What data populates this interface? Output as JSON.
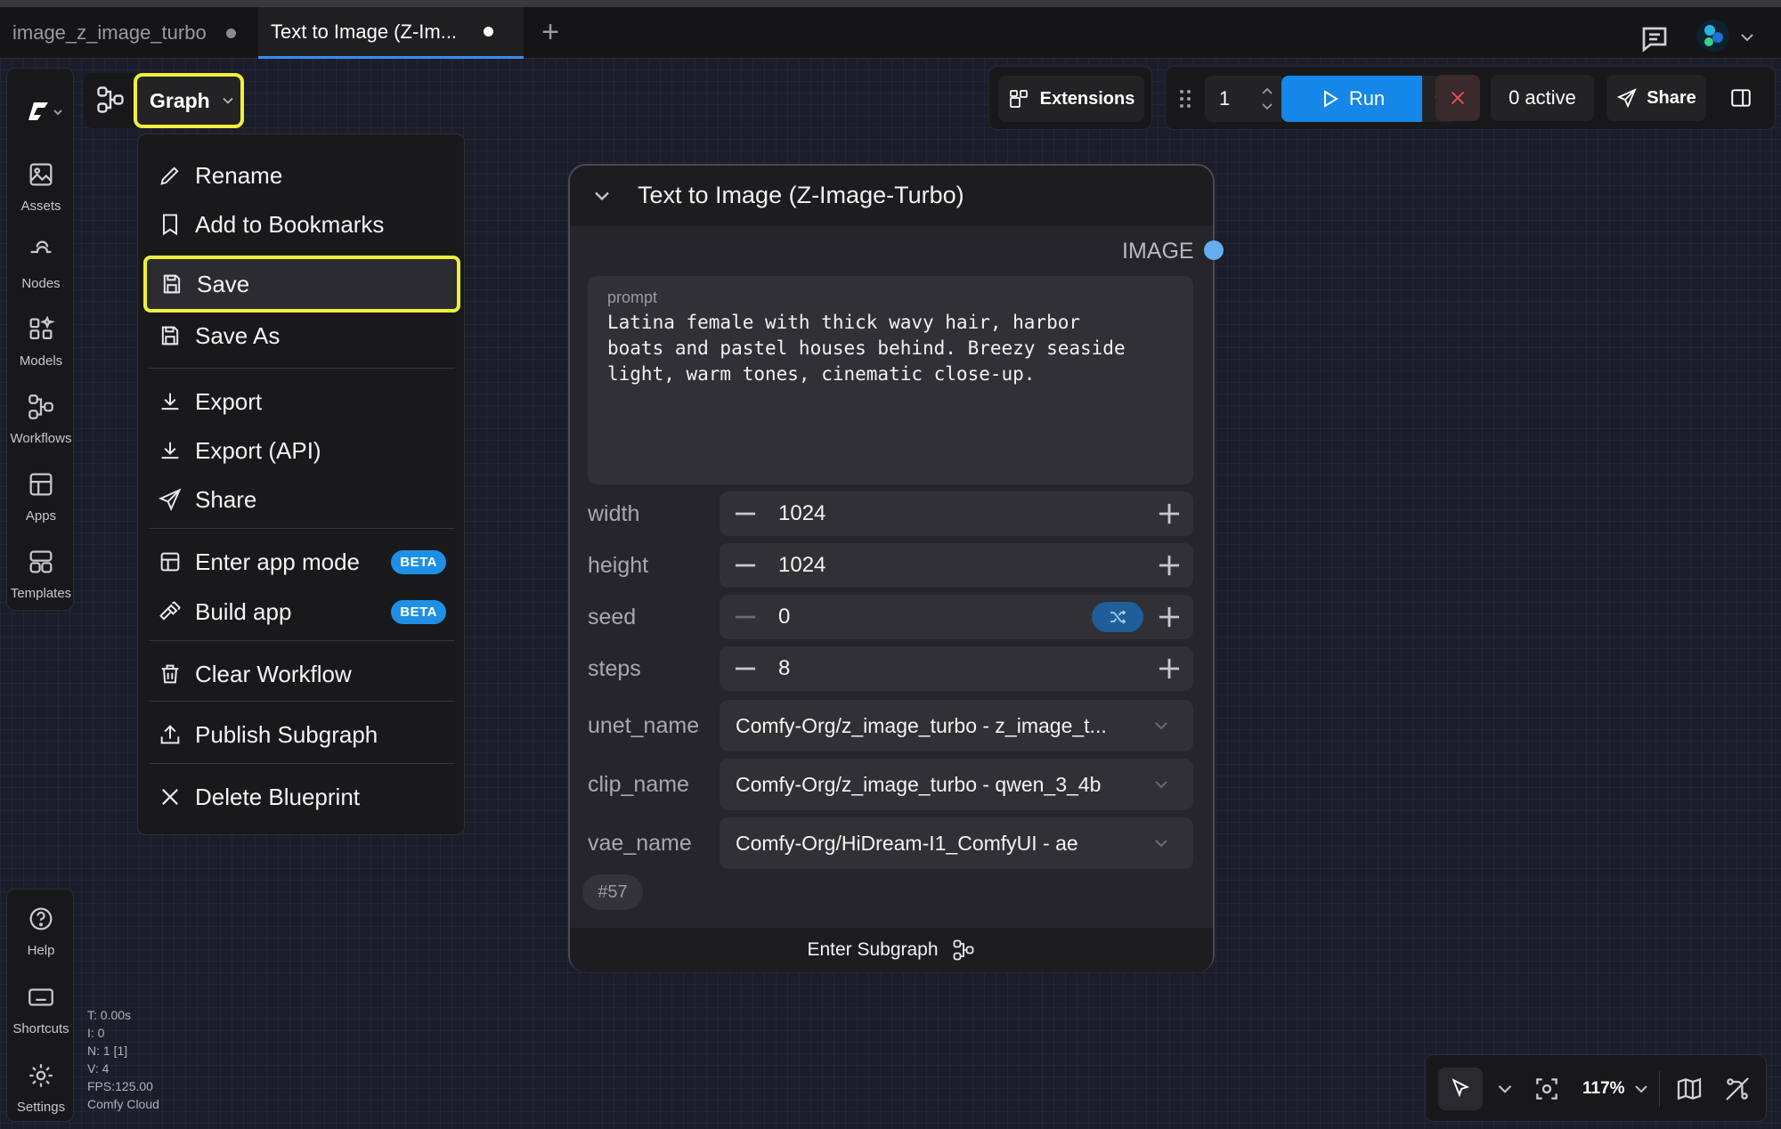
{
  "tabs": [
    {
      "label": "image_z_image_turbo",
      "unsaved": true,
      "active": false
    },
    {
      "label": "Text to Image (Z-Im...",
      "unsaved": true,
      "active": true
    }
  ],
  "tab_add_label": "+",
  "sidebar": {
    "items": [
      {
        "label": "Assets",
        "icon": "image-icon"
      },
      {
        "label": "Nodes",
        "icon": "node-icon"
      },
      {
        "label": "Models",
        "icon": "models-icon"
      },
      {
        "label": "Workflows",
        "icon": "workflow-icon"
      },
      {
        "label": "Apps",
        "icon": "apps-icon"
      },
      {
        "label": "Templates",
        "icon": "templates-icon"
      }
    ],
    "bottom_items": [
      {
        "label": "Help",
        "icon": "help-icon"
      },
      {
        "label": "Shortcuts",
        "icon": "keyboard-icon"
      },
      {
        "label": "Settings",
        "icon": "gear-icon"
      }
    ]
  },
  "graph_button_label": "Graph",
  "menu": {
    "items": [
      {
        "label": "Rename",
        "icon": "pencil-icon"
      },
      {
        "label": "Add to Bookmarks",
        "icon": "bookmark-icon"
      },
      {
        "label": "Save",
        "icon": "save-icon",
        "highlighted": true
      },
      {
        "label": "Save As",
        "icon": "save-icon"
      },
      {
        "label": "Export",
        "icon": "download-icon"
      },
      {
        "label": "Export (API)",
        "icon": "download-icon"
      },
      {
        "label": "Share",
        "icon": "send-icon"
      },
      {
        "label": "Enter app mode",
        "icon": "layout-icon",
        "badge": "BETA"
      },
      {
        "label": "Build app",
        "icon": "hammer-icon",
        "badge": "BETA"
      },
      {
        "label": "Clear Workflow",
        "icon": "trash-icon"
      },
      {
        "label": "Publish Subgraph",
        "icon": "upload-icon"
      },
      {
        "label": "Delete Blueprint",
        "icon": "close-icon"
      }
    ]
  },
  "toolbar": {
    "extensions_label": "Extensions",
    "queue_count": "1",
    "run_label": "Run",
    "active_label": "0 active",
    "share_label": "Share"
  },
  "node": {
    "title": "Text to Image (Z-Image-Turbo)",
    "output_label": "IMAGE",
    "prompt_label": "prompt",
    "prompt_text": "Latina female with thick wavy hair, harbor\nboats and pastel houses behind. Breezy seaside\nlight, warm tones, cinematic close-up.",
    "widgets": [
      {
        "label": "width",
        "value": "1024"
      },
      {
        "label": "height",
        "value": "1024"
      },
      {
        "label": "seed",
        "value": "0"
      },
      {
        "label": "steps",
        "value": "8"
      }
    ],
    "combos": [
      {
        "label": "unet_name",
        "value": "Comfy-Org/z_image_turbo - z_image_t..."
      },
      {
        "label": "clip_name",
        "value": "Comfy-Org/z_image_turbo - qwen_3_4b"
      },
      {
        "label": "vae_name",
        "value": "Comfy-Org/HiDream-I1_ComfyUI - ae"
      }
    ],
    "id_badge": "#57",
    "footer_label": "Enter Subgraph"
  },
  "stats": [
    "T: 0.00s",
    "I: 0",
    "N: 1 [1]",
    "V: 4",
    "FPS:125.00",
    "Comfy Cloud"
  ],
  "canvas_tools": {
    "zoom": "117%"
  },
  "colors": {
    "accent": "#1487e8",
    "highlight": "#eef03a",
    "output_dot": "#62aef0"
  }
}
